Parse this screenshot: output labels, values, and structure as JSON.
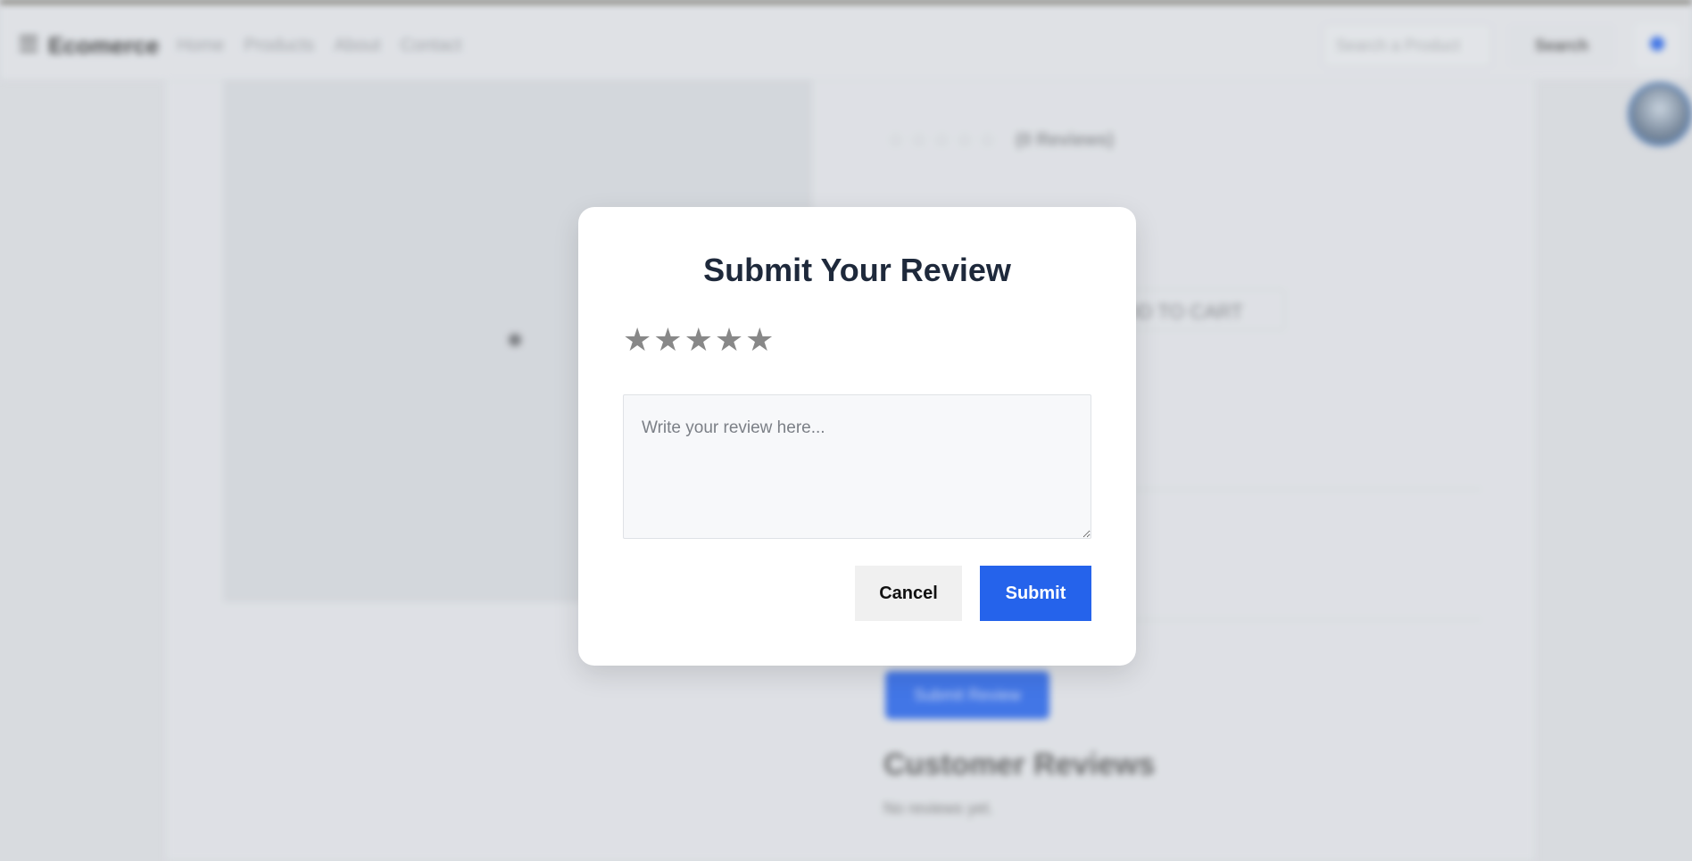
{
  "navbar": {
    "brand": "Ecomerce",
    "links": [
      "Home",
      "Products",
      "About",
      "Contact"
    ],
    "search_placeholder": "Search a Product",
    "search_button": "Search"
  },
  "product": {
    "reviews_count": "(0 Reviews)",
    "add_to_cart": "ADD TO CART",
    "submit_review_button": "Submit Review"
  },
  "reviews_section": {
    "title": "Customer Reviews",
    "empty_text": "No reviews yet."
  },
  "modal": {
    "title": "Submit Your Review",
    "rating": {
      "max": 5,
      "value": 0,
      "star_glyph": "★"
    },
    "review_placeholder": "Write your review here...",
    "review_value": "",
    "cancel_label": "Cancel",
    "submit_label": "Submit"
  },
  "colors": {
    "primary": "#2563eb",
    "title": "#1e293b",
    "star_inactive": "#888888"
  }
}
